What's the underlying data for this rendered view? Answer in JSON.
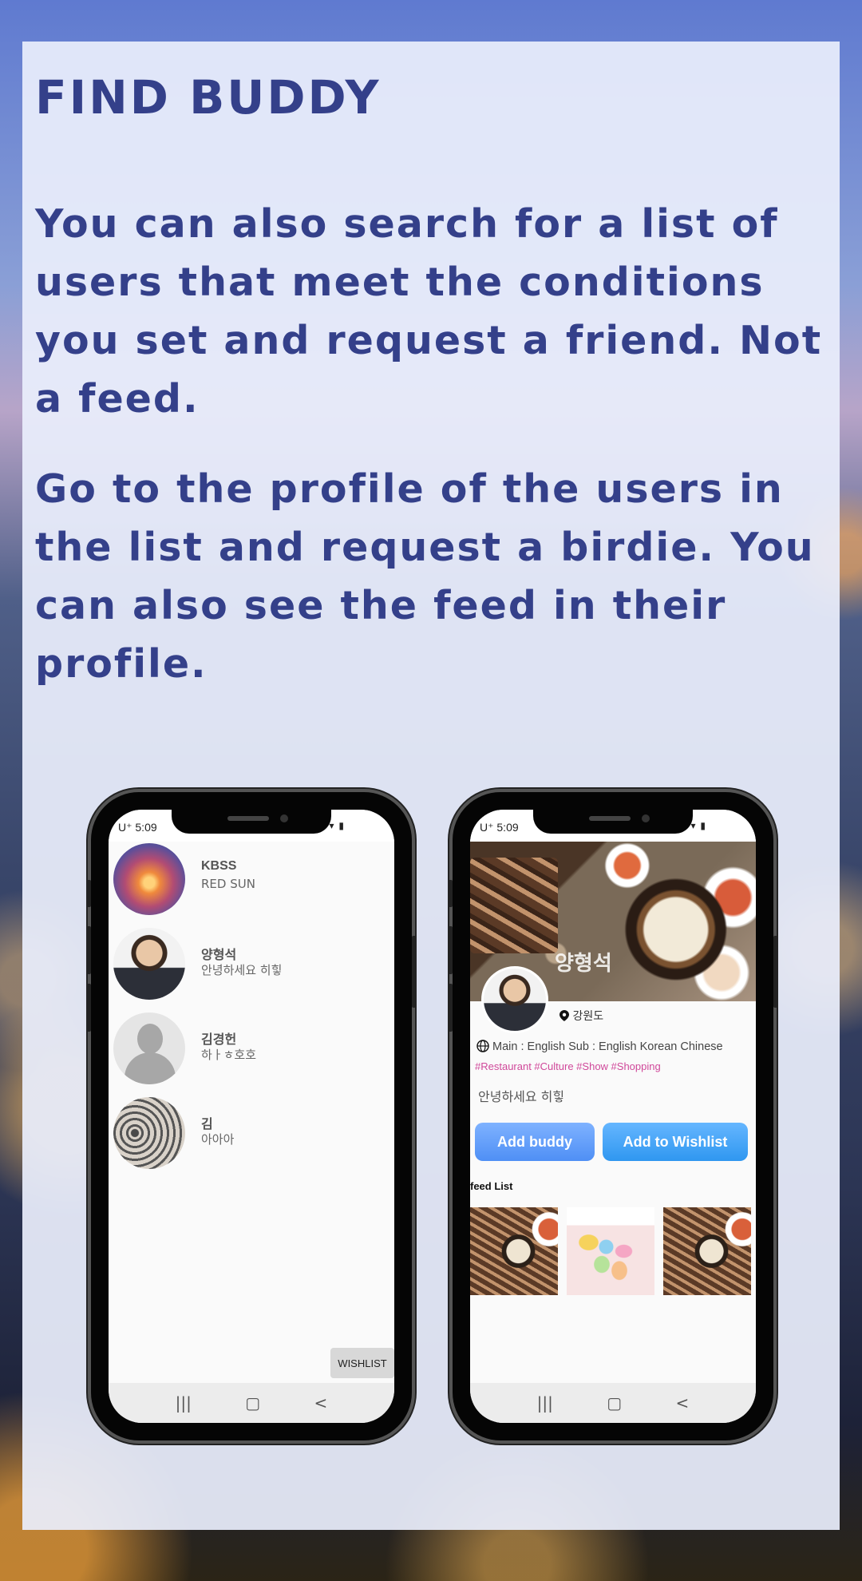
{
  "headline": "FIND BUDDY",
  "paragraphs": [
    "You can also search for a list of users that meet the conditions you set and request a friend. Not a feed.",
    "Go to the profile of the users in the list and request a birdie. You can also see the feed in their profile."
  ],
  "status": {
    "time": "U⁺ 5:09",
    "icons": "▣ ▾ ▮"
  },
  "user_list": {
    "users": [
      {
        "name": "KBSS",
        "message": "RED SUN"
      },
      {
        "name": "양형석",
        "message": "안녕하세요 히힣"
      },
      {
        "name": "김경헌",
        "message": "하ㅏㅎ호호"
      },
      {
        "name": "김",
        "message": "아아아"
      }
    ],
    "wishlist_label": "WISHLIST"
  },
  "profile": {
    "name": "양형석",
    "location": "강원도",
    "languages": "Main : English  Sub :  English  Korean  Chinese",
    "tags": "#Restaurant #Culture #Show #Shopping",
    "intro": "안녕하세요 히힣",
    "add_buddy_label": "Add buddy",
    "add_wishlist_label": "Add to Wishlist",
    "feed_title": "feed List"
  },
  "nav": {
    "recent": "|||",
    "home": "▢",
    "back": "<"
  },
  "icons": [
    "location-pin-icon",
    "globe-icon",
    "signal-icon",
    "battery-icon"
  ],
  "colors": {
    "headline": "#34408a",
    "accent_blue": "#4f8ff5",
    "tag_pink": "#d0489a"
  }
}
